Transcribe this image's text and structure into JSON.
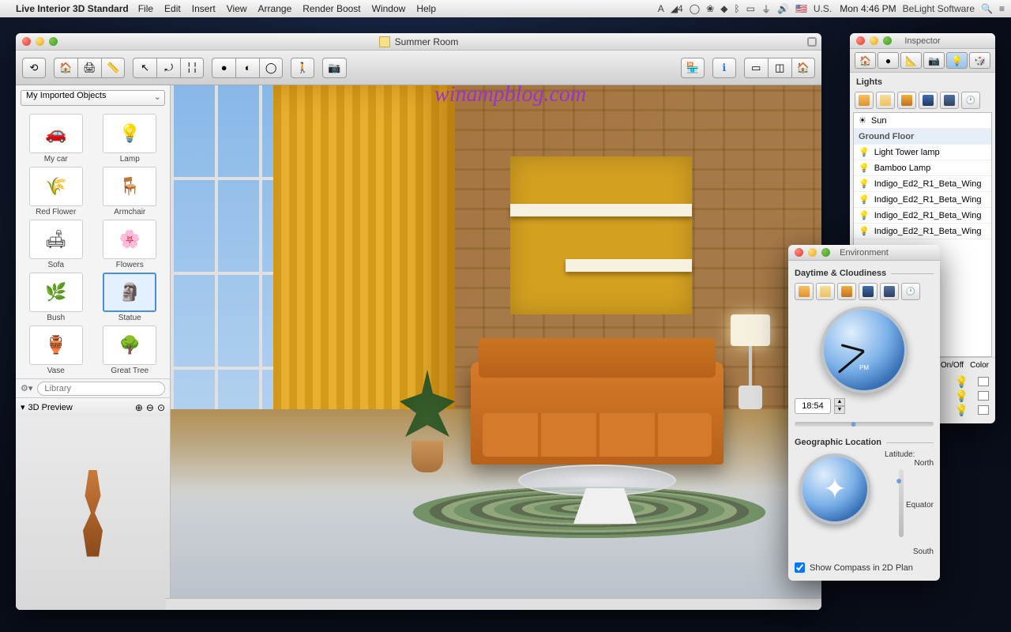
{
  "menubar": {
    "app": "Live Interior 3D Standard",
    "items": [
      "File",
      "Edit",
      "Insert",
      "View",
      "Arrange",
      "Render Boost",
      "Window",
      "Help"
    ],
    "clock": "Mon 4:46 PM",
    "right_app": "BeLight Software",
    "locale": "U.S."
  },
  "main": {
    "title": "Summer Room",
    "library_selector": "My Imported Objects",
    "objects": [
      {
        "label": "My car",
        "glyph": "🚗"
      },
      {
        "label": "Lamp",
        "glyph": "💡"
      },
      {
        "label": "Red Flower",
        "glyph": "🌾"
      },
      {
        "label": "Armchair",
        "glyph": "🪑"
      },
      {
        "label": "Sofa",
        "glyph": "🛋"
      },
      {
        "label": "Flowers",
        "glyph": "🌸"
      },
      {
        "label": "Bush",
        "glyph": "🌿"
      },
      {
        "label": "Statue",
        "glyph": "🗿",
        "selected": true
      },
      {
        "label": "Vase",
        "glyph": "🏺"
      },
      {
        "label": "Great Tree",
        "glyph": "🌳"
      }
    ],
    "library_search_placeholder": "Library",
    "preview_title": "3D Preview"
  },
  "inspector": {
    "title": "Inspector",
    "section": "Lights",
    "rows": [
      {
        "type": "item",
        "icon": "☀",
        "label": "Sun"
      },
      {
        "type": "group",
        "label": "Ground Floor"
      },
      {
        "type": "item",
        "icon": "💡",
        "label": "Light Tower lamp"
      },
      {
        "type": "item",
        "icon": "💡",
        "label": "Bamboo Lamp"
      },
      {
        "type": "item",
        "icon": "💡",
        "label": "Indigo_Ed2_R1_Beta_Wing"
      },
      {
        "type": "item",
        "icon": "💡",
        "label": "Indigo_Ed2_R1_Beta_Wing"
      },
      {
        "type": "item",
        "icon": "💡",
        "label": "Indigo_Ed2_R1_Beta_Wing"
      },
      {
        "type": "item",
        "icon": "💡",
        "label": "Indigo_Ed2_R1_Beta_Wing"
      }
    ],
    "col_on": "On/Off",
    "col_color": "Color"
  },
  "environment": {
    "title": "Environment",
    "daytime_label": "Daytime & Cloudiness",
    "clock_period": "PM",
    "time": "18:54",
    "geo_label": "Geographic Location",
    "lat_label": "Latitude:",
    "lat_north": "North",
    "lat_equator": "Equator",
    "lat_south": "South",
    "show_compass": "Show Compass in 2D Plan"
  },
  "watermark": "winampblog.com"
}
